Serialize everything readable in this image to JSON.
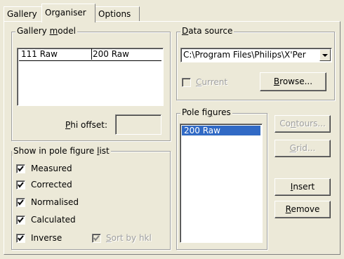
{
  "tabs": [
    {
      "label": "Gallery"
    },
    {
      "label": "Organiser"
    },
    {
      "label": "Options"
    }
  ],
  "gallery_model": {
    "legend_pre": "Gallery ",
    "legend_u": "m",
    "legend_post": "odel",
    "columns": [
      "111 Raw",
      "200 Raw"
    ],
    "phi_offset_pre": "",
    "phi_offset_u": "P",
    "phi_offset_post": "hi offset:",
    "phi_offset_value": ""
  },
  "show_list": {
    "legend_pre": "Show in pole figure ",
    "legend_u": "l",
    "legend_post": "ist",
    "items": [
      {
        "label": "Measured",
        "checked": true
      },
      {
        "label": "Corrected",
        "checked": true
      },
      {
        "label": "Normalised",
        "checked": true
      },
      {
        "label": "Calculated",
        "checked": true
      },
      {
        "label": "Inverse",
        "checked": true
      }
    ],
    "sort_by_hkl_u": "S",
    "sort_by_hkl_post": "ort by hkl"
  },
  "data_source": {
    "legend_u": "D",
    "legend_post": "ata source",
    "path": "C:\\Program Files\\Philips\\X'Per",
    "current_u": "C",
    "current_post": "urrent",
    "browse_u": "B",
    "browse_post": "rowse..."
  },
  "pole_figures": {
    "legend_pre": "Pole fi",
    "legend_u": "g",
    "legend_post": "ures",
    "items": [
      "200 Raw"
    ]
  },
  "buttons": {
    "contours_pre": "Co",
    "contours_u": "n",
    "contours_post": "tours...",
    "grid_u": "G",
    "grid_post": "rid...",
    "insert_u": "I",
    "insert_post": "nsert",
    "remove_u": "R",
    "remove_post": "emove"
  }
}
